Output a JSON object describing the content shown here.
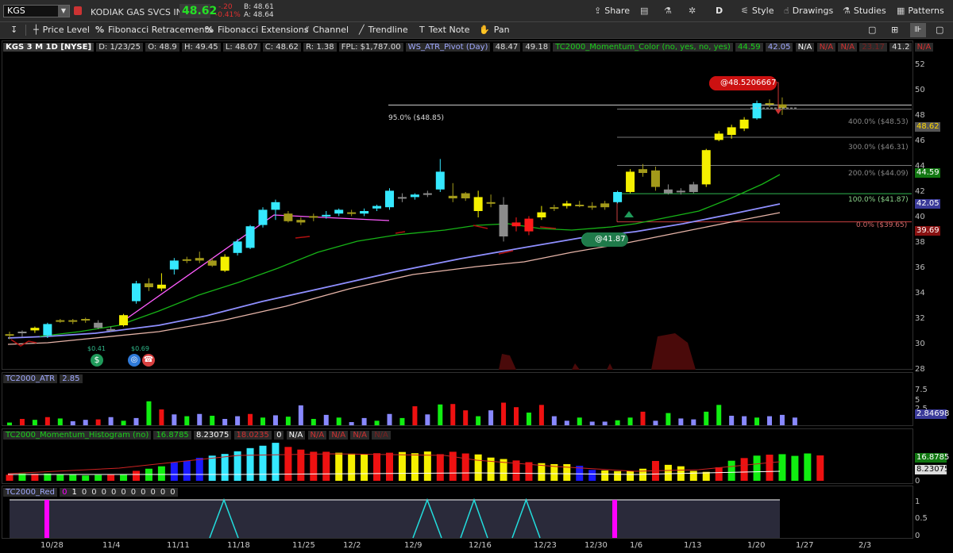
{
  "header": {
    "symbol": "KGS",
    "company": "KODIAK GAS SVCS INC",
    "last": "48.62",
    "change": "-.20",
    "change_pct": "-0.41%",
    "bid": "B: 48.61",
    "ask": "A: 48.64",
    "share_label": "Share",
    "period": "D",
    "style_label": "Style",
    "drawings_label": "Drawings",
    "studies_label": "Studies",
    "patterns_label": "Patterns"
  },
  "toolbar": {
    "price_level": "Price Level",
    "fib_retracements": "Fibonacci Retracements",
    "fib_extensions": "Fibonacci Extensions",
    "channel": "Channel",
    "trendline": "Trendline",
    "text_note": "Text Note",
    "pan": "Pan"
  },
  "chart_header": {
    "title": "KGS 3 M 1D [NYSE]",
    "date": "D: 1/23/25",
    "open": "O: 48.9",
    "high": "H: 49.45",
    "low": "L: 48.07",
    "close": "C: 48.62",
    "range": "R: 1.38",
    "fpl": "FPL: $1,787.00",
    "ws_atr": "WS_ATR_Pivot (Day)",
    "ws_atr_v1": "48.47",
    "ws_atr_v2": "49.18",
    "mom_color": "TC2000_Momentum_Color (no, yes, no, yes)",
    "mom_v1": "44.59",
    "mom_v2": "42.05",
    "mom_v3": "N/A",
    "mom_v4": "N/A",
    "mom_v5": "N/A",
    "mom_v6": "23.17",
    "mom_v7": "41.2",
    "mom_v8": "N/A"
  },
  "annotations": {
    "alert_price": "@48.5206667",
    "entry_price": "@41.87",
    "fib_95": "95.0%  ($48.85)",
    "fib_400": "400.0%  ($48.53)",
    "fib_300": "300.0%  ($46.31)",
    "fib_200": "200.0%  ($44.09)",
    "fib_100": "100.0%  ($41.87)",
    "fib_0": "0.0%  ($39.65)",
    "div1": "$0.41",
    "div2": "$0.69"
  },
  "right_tags": {
    "last": "48.62",
    "ema1": "44.59",
    "ema2": "42.05",
    "fib0": "39.69",
    "atr": "2.84698",
    "hist1": "16.8785",
    "hist2": "8.23075"
  },
  "atr_panel": {
    "title": "TC2000_ATR",
    "value": "2.85"
  },
  "hist_panel": {
    "title": "TC2000_Momentum_Histogram (no)",
    "v1": "16.8785",
    "v2": "8.23075",
    "v3": "18.0235",
    "v4": "0",
    "v5": "N/A",
    "v6": "N/A",
    "v7": "N/A",
    "v8": "N/A",
    "v9": "N/A"
  },
  "red_panel": {
    "title": "TC2000_Red",
    "values": [
      "0",
      "1",
      "0",
      "0",
      "0",
      "0",
      "0",
      "0",
      "0",
      "0",
      "0",
      "0"
    ]
  },
  "axis_labels": {
    "price": [
      "52",
      "50",
      "48",
      "46",
      "44",
      "42",
      "40",
      "38",
      "36",
      "34",
      "32",
      "30",
      "28"
    ],
    "atr": [
      "7.5",
      "5",
      "2.5"
    ],
    "hist": [
      "0"
    ],
    "red": [
      "1",
      "0.5",
      "0"
    ],
    "dates": [
      "10/28",
      "11/4",
      "11/11",
      "11/18",
      "11/25",
      "12/2",
      "12/9",
      "12/16",
      "12/23",
      "12/30",
      "1/6",
      "1/13",
      "1/20",
      "1/27",
      "2/3"
    ]
  },
  "colors": {
    "bull": "#35e8ff",
    "yellow": "#f5f000",
    "olive": "#a39a1a",
    "red": "#ff1a1a",
    "gray": "#8c8c8c",
    "ema_green": "#17b317",
    "ema_blue": "#8f8fff",
    "ema_pink": "#e6b4a8",
    "hist_green": "#22dd22",
    "hist_blue": "#1a1aff",
    "red_pink": "#ff00ff",
    "red_cyan": "#22dddd"
  },
  "chart_data": {
    "type": "candlestick",
    "symbol": "KGS",
    "ylim": [
      28,
      53
    ],
    "candles": [
      {
        "o": 30.8,
        "h": 31.0,
        "l": 30.4,
        "c": 30.7,
        "col": "olive"
      },
      {
        "o": 30.9,
        "h": 31.1,
        "l": 30.6,
        "c": 31.0,
        "col": "gray"
      },
      {
        "o": 31.1,
        "h": 31.4,
        "l": 30.9,
        "c": 31.3,
        "col": "yellow"
      },
      {
        "o": 30.7,
        "h": 31.7,
        "l": 30.5,
        "c": 31.6,
        "col": "bull"
      },
      {
        "o": 31.9,
        "h": 32.0,
        "l": 31.7,
        "c": 31.8,
        "col": "olive"
      },
      {
        "o": 31.8,
        "h": 32.0,
        "l": 31.6,
        "c": 31.9,
        "col": "olive"
      },
      {
        "o": 31.9,
        "h": 32.1,
        "l": 31.7,
        "c": 32.0,
        "col": "olive"
      },
      {
        "o": 31.7,
        "h": 31.9,
        "l": 31.2,
        "c": 31.3,
        "col": "gray"
      },
      {
        "o": 31.2,
        "h": 31.4,
        "l": 31.0,
        "c": 31.2,
        "col": "gray"
      },
      {
        "o": 31.5,
        "h": 32.4,
        "l": 31.4,
        "c": 32.3,
        "col": "yellow"
      },
      {
        "o": 33.4,
        "h": 35.0,
        "l": 33.2,
        "c": 34.8,
        "col": "bull"
      },
      {
        "o": 34.5,
        "h": 35.2,
        "l": 34.2,
        "c": 34.8,
        "col": "olive"
      },
      {
        "o": 34.4,
        "h": 35.6,
        "l": 34.2,
        "c": 34.7,
        "col": "yellow"
      },
      {
        "o": 35.9,
        "h": 36.8,
        "l": 35.5,
        "c": 36.6,
        "col": "bull"
      },
      {
        "o": 36.7,
        "h": 36.9,
        "l": 36.4,
        "c": 36.6,
        "col": "olive"
      },
      {
        "o": 36.8,
        "h": 37.3,
        "l": 36.4,
        "c": 36.6,
        "col": "olive"
      },
      {
        "o": 36.6,
        "h": 36.8,
        "l": 36.1,
        "c": 36.2,
        "col": "olive"
      },
      {
        "o": 35.8,
        "h": 37.1,
        "l": 35.7,
        "c": 36.9,
        "col": "yellow"
      },
      {
        "o": 37.2,
        "h": 38.3,
        "l": 37.0,
        "c": 38.1,
        "col": "bull"
      },
      {
        "o": 37.6,
        "h": 39.4,
        "l": 37.5,
        "c": 39.3,
        "col": "bull"
      },
      {
        "o": 39.4,
        "h": 40.8,
        "l": 39.2,
        "c": 40.6,
        "col": "bull"
      },
      {
        "o": 40.6,
        "h": 41.4,
        "l": 39.8,
        "c": 41.2,
        "col": "bull"
      },
      {
        "o": 40.3,
        "h": 40.5,
        "l": 39.6,
        "c": 39.7,
        "col": "olive"
      },
      {
        "o": 39.6,
        "h": 40.0,
        "l": 39.4,
        "c": 39.8,
        "col": "olive"
      },
      {
        "o": 40.0,
        "h": 40.3,
        "l": 39.7,
        "c": 40.1,
        "col": "olive"
      },
      {
        "o": 40.1,
        "h": 40.5,
        "l": 39.9,
        "c": 40.2,
        "col": "bull"
      },
      {
        "o": 40.3,
        "h": 40.7,
        "l": 40.1,
        "c": 40.6,
        "col": "bull"
      },
      {
        "o": 40.4,
        "h": 40.6,
        "l": 40.1,
        "c": 40.3,
        "col": "olive"
      },
      {
        "o": 40.3,
        "h": 40.7,
        "l": 40.1,
        "c": 40.5,
        "col": "bull"
      },
      {
        "o": 40.7,
        "h": 41.0,
        "l": 40.5,
        "c": 40.9,
        "col": "bull"
      },
      {
        "o": 40.8,
        "h": 42.3,
        "l": 40.6,
        "c": 42.1,
        "col": "bull"
      },
      {
        "o": 41.5,
        "h": 41.9,
        "l": 41.2,
        "c": 41.6,
        "col": "gray"
      },
      {
        "o": 41.6,
        "h": 41.9,
        "l": 41.4,
        "c": 41.8,
        "col": "bull"
      },
      {
        "o": 41.8,
        "h": 42.1,
        "l": 41.6,
        "c": 41.9,
        "col": "gray"
      },
      {
        "o": 42.2,
        "h": 44.6,
        "l": 42.0,
        "c": 43.6,
        "col": "bull"
      },
      {
        "o": 41.7,
        "h": 42.7,
        "l": 41.2,
        "c": 41.5,
        "col": "olive"
      },
      {
        "o": 41.9,
        "h": 42.0,
        "l": 41.3,
        "c": 41.5,
        "col": "olive"
      },
      {
        "o": 41.6,
        "h": 42.1,
        "l": 40.0,
        "c": 40.5,
        "col": "yellow"
      },
      {
        "o": 41.2,
        "h": 41.8,
        "l": 40.8,
        "c": 41.1,
        "col": "olive"
      },
      {
        "o": 38.5,
        "h": 41.6,
        "l": 38.1,
        "c": 41.0,
        "col": "gray"
      },
      {
        "o": 39.3,
        "h": 40.0,
        "l": 38.9,
        "c": 39.6,
        "col": "red"
      },
      {
        "o": 38.9,
        "h": 40.1,
        "l": 38.6,
        "c": 39.9,
        "col": "red"
      },
      {
        "o": 40.0,
        "h": 40.9,
        "l": 39.8,
        "c": 40.4,
        "col": "yellow"
      },
      {
        "o": 40.8,
        "h": 41.0,
        "l": 40.5,
        "c": 40.7,
        "col": "olive"
      },
      {
        "o": 40.9,
        "h": 41.3,
        "l": 40.7,
        "c": 41.1,
        "col": "yellow"
      },
      {
        "o": 41.0,
        "h": 41.3,
        "l": 40.8,
        "c": 41.0,
        "col": "olive"
      },
      {
        "o": 40.9,
        "h": 41.2,
        "l": 40.6,
        "c": 40.8,
        "col": "olive"
      },
      {
        "o": 40.8,
        "h": 41.3,
        "l": 40.6,
        "c": 41.1,
        "col": "olive"
      },
      {
        "o": 41.2,
        "h": 42.1,
        "l": 41.1,
        "c": 42.0,
        "col": "bull"
      },
      {
        "o": 42.0,
        "h": 43.8,
        "l": 41.9,
        "c": 43.6,
        "col": "yellow"
      },
      {
        "o": 43.5,
        "h": 44.2,
        "l": 43.2,
        "c": 43.8,
        "col": "olive"
      },
      {
        "o": 43.7,
        "h": 44.0,
        "l": 42.1,
        "c": 42.4,
        "col": "olive"
      },
      {
        "o": 42.2,
        "h": 42.6,
        "l": 41.8,
        "c": 41.9,
        "col": "gray"
      },
      {
        "o": 42.0,
        "h": 42.3,
        "l": 41.8,
        "c": 42.1,
        "col": "gray"
      },
      {
        "o": 42.0,
        "h": 42.8,
        "l": 41.9,
        "c": 42.6,
        "col": "gray"
      },
      {
        "o": 42.6,
        "h": 45.4,
        "l": 42.4,
        "c": 45.3,
        "col": "yellow"
      },
      {
        "o": 46.1,
        "h": 46.8,
        "l": 46.0,
        "c": 46.6,
        "col": "yellow"
      },
      {
        "o": 46.5,
        "h": 47.3,
        "l": 46.2,
        "c": 47.1,
        "col": "yellow"
      },
      {
        "o": 47.0,
        "h": 47.9,
        "l": 46.8,
        "c": 47.7,
        "col": "yellow"
      },
      {
        "o": 47.8,
        "h": 49.2,
        "l": 47.7,
        "c": 49.0,
        "col": "bull"
      },
      {
        "o": 48.9,
        "h": 49.3,
        "l": 48.7,
        "c": 49.0,
        "col": "olive"
      },
      {
        "o": 48.9,
        "h": 49.45,
        "l": 48.07,
        "c": 48.62,
        "col": "olive"
      }
    ],
    "atr_values": [
      0.6,
      1.4,
      1.2,
      1.8,
      1.5,
      0.9,
      1.2,
      1.3,
      1.8,
      1.0,
      1.6,
      5.3,
      3.5,
      2.4,
      2.0,
      2.5,
      2.1,
      1.4,
      2.0,
      2.5,
      1.7,
      2.2,
      1.9,
      4.4,
      1.4,
      2.3,
      1.7,
      0.7,
      1.6,
      1.0,
      2.5,
      1.6,
      4.2,
      2.4,
      4.6,
      4.7,
      3.3,
      2.0,
      3.3,
      5.0,
      4.0,
      2.8,
      4.5,
      2.0,
      1.0,
      1.7,
      0.8,
      0.8,
      1.1,
      1.7,
      3.0,
      1.0,
      2.7,
      1.5,
      1.3,
      3.0,
      4.5,
      2.1,
      2.0,
      1.7,
      2.0,
      2.3,
      1.7
    ],
    "atr_colors": [
      "g",
      "r",
      "g",
      "r",
      "g",
      "b",
      "b",
      "r",
      "b",
      "g",
      "b",
      "g",
      "r",
      "b",
      "g",
      "b",
      "g",
      "b",
      "b",
      "r",
      "g",
      "b",
      "g",
      "b",
      "g",
      "b",
      "g",
      "b",
      "b",
      "g",
      "b",
      "g",
      "r",
      "b",
      "g",
      "r",
      "r",
      "g",
      "b",
      "r",
      "r",
      "g",
      "r",
      "b",
      "b",
      "g",
      "b",
      "b",
      "g",
      "g",
      "r",
      "b",
      "g",
      "b",
      "b",
      "g",
      "g",
      "b",
      "b",
      "g",
      "b",
      "b",
      "b"
    ],
    "hist_values": [
      2.5,
      3.0,
      2.9,
      3.0,
      2.8,
      2.5,
      2.2,
      2.4,
      2.5,
      2.7,
      4.1,
      5.0,
      6.0,
      7.6,
      8.2,
      9.5,
      10.4,
      11.1,
      12.2,
      13.5,
      14.5,
      15.7,
      14.0,
      12.9,
      12.0,
      12.0,
      11.6,
      11.2,
      11.0,
      11.4,
      11.6,
      11.9,
      11.4,
      12.1,
      11.0,
      12.0,
      11.3,
      10.9,
      9.6,
      9.0,
      8.4,
      7.7,
      7.3,
      6.9,
      6.9,
      6.2,
      4.5,
      4.3,
      4.0,
      4.1,
      5.0,
      8.2,
      6.6,
      6.0,
      4.1,
      3.7,
      5.6,
      8.3,
      9.4,
      10.4,
      10.8,
      11.0,
      10.3,
      11.3,
      10.5
    ],
    "hist_colors": [
      "r",
      "g",
      "r",
      "g",
      "g",
      "g",
      "g",
      "g",
      "r",
      "g",
      "r",
      "g",
      "g",
      "b",
      "b",
      "b",
      "c",
      "c",
      "c",
      "c",
      "c",
      "c",
      "r",
      "r",
      "r",
      "r",
      "y",
      "y",
      "y",
      "r",
      "r",
      "y",
      "y",
      "y",
      "r",
      "r",
      "r",
      "y",
      "y",
      "y",
      "r",
      "r",
      "y",
      "y",
      "y",
      "b",
      "b",
      "y",
      "y",
      "y",
      "y",
      "r",
      "y",
      "y",
      "y",
      "y",
      "r",
      "g",
      "r",
      "g",
      "r",
      "g",
      "g",
      "g",
      "r",
      "r",
      "r"
    ],
    "red_signal": [
      0,
      1,
      0,
      0,
      0,
      0,
      0,
      0,
      0,
      0,
      0,
      0
    ],
    "fib_levels": [
      {
        "pct": "95.0%",
        "price": 48.85
      },
      {
        "pct": "400.0%",
        "price": 48.53
      },
      {
        "pct": "300.0%",
        "price": 46.31
      },
      {
        "pct": "200.0%",
        "price": 44.09
      },
      {
        "pct": "100.0%",
        "price": 41.87
      },
      {
        "pct": "0.0%",
        "price": 39.65
      }
    ],
    "x_dates": [
      "10/28",
      "11/4",
      "11/11",
      "11/18",
      "11/25",
      "12/2",
      "12/9",
      "12/16",
      "12/23",
      "12/30",
      "1/6",
      "1/13",
      "1/20",
      "1/27",
      "2/3"
    ]
  }
}
